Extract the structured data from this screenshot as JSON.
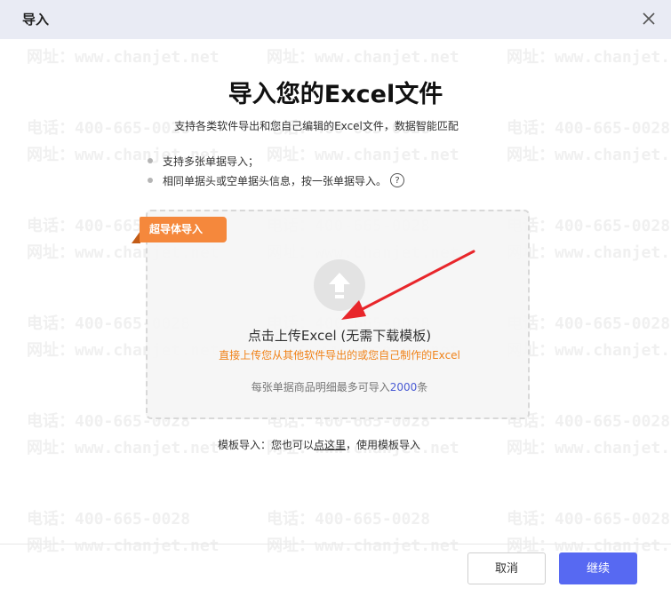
{
  "dialog": {
    "title": "导入",
    "close_icon": "close-icon"
  },
  "watermark": {
    "phone": "电话：400-665-0028",
    "site": "网址：www.chanjet.net"
  },
  "content": {
    "heading": "导入您的Excel文件",
    "subtitle": "支持各类软件导出和您自己编辑的Excel文件，数据智能匹配",
    "bullets": [
      "支持多张单据导入；",
      "相同单据头或空单据头信息，按一张单据导入。"
    ],
    "help_icon": "question-circle-icon",
    "help_glyph": "?"
  },
  "upload": {
    "badge": "超导体导入",
    "icon": "upload-arrow-icon",
    "main_text": "点击上传Excel (无需下载模板)",
    "sub_text": "直接上传您从其他软件导出的或您自己制作的Excel",
    "limit_prefix": "每张单据商品明细最多可导入",
    "limit_number": "2000",
    "limit_suffix": "条"
  },
  "template": {
    "prefix": "模板导入：您也可以",
    "link": "点这里",
    "suffix": "，使用模板导入"
  },
  "footer": {
    "cancel_label": "取消",
    "continue_label": "继续"
  },
  "colors": {
    "accent": "#5769f2",
    "badge": "#f5883c",
    "arrow": "#e8262b",
    "hint": "#f0831a"
  }
}
